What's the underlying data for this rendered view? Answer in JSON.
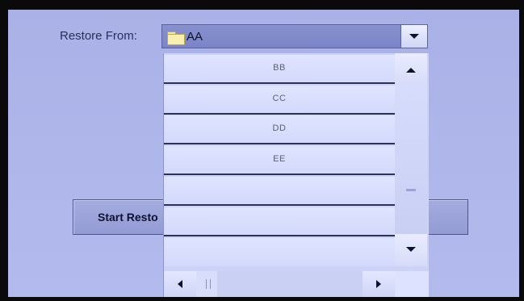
{
  "restore": {
    "label": "Restore From:",
    "selected_value": "AA",
    "selected_icon": "folder-icon"
  },
  "start_button": {
    "label": "Start Resto"
  },
  "dropdown": {
    "items": [
      {
        "label": "BB"
      },
      {
        "label": "CC"
      },
      {
        "label": "DD"
      },
      {
        "label": "EE"
      },
      {
        "label": ""
      },
      {
        "label": ""
      },
      {
        "label": ""
      }
    ]
  },
  "icons": {
    "combo_arrow": "chevron-down-icon",
    "scroll_up": "arrow-up-icon",
    "scroll_down": "arrow-down-icon",
    "scroll_left": "arrow-left-icon",
    "scroll_right": "arrow-right-icon"
  },
  "colors": {
    "screen_background": "#aeb6ea",
    "combo_background": "#8088ca",
    "list_item_background": "#dbe0fd"
  }
}
